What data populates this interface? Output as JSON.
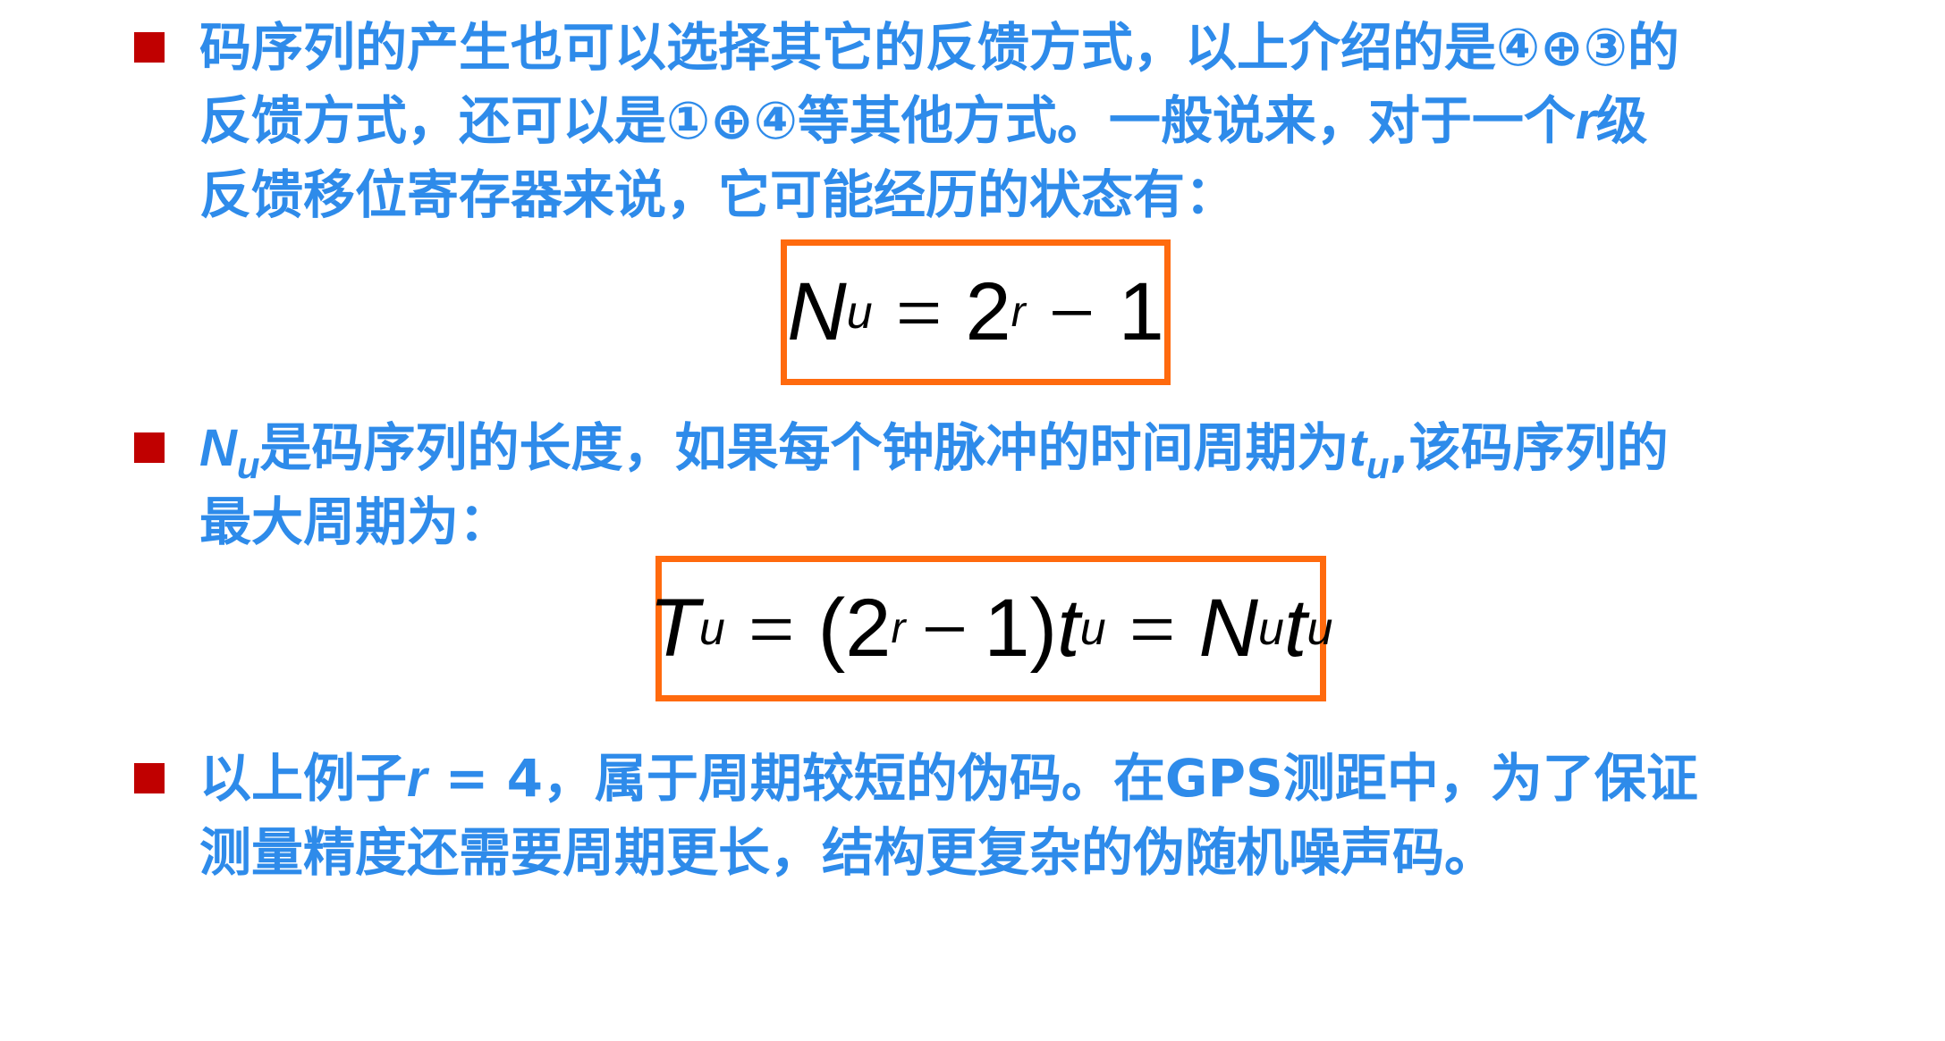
{
  "colors": {
    "text": "#2e8bea",
    "bullet": "#c00000",
    "formula_border": "#ff6a0e",
    "formula_text": "#000000"
  },
  "bullet1": {
    "line1": "码序列的产生也可以选择其它的反馈方式，以上介绍的是④⊕③的",
    "line2_a": "反馈方式，还可以是①⊕④等其他方式。一般说来，对于一个",
    "line2_var": "r",
    "line2_b": "级",
    "line3": "反馈移位寄存器来说，它可能经历的状态有："
  },
  "formula1": {
    "lhs": "N",
    "lhs_sub": "u",
    "eq": "=",
    "base": "2",
    "exp": "r",
    "minus": "−",
    "one": "1"
  },
  "bullet2": {
    "var_n": "N",
    "var_n_sub": "u",
    "line1_a": "是码序列的长度，如果每个钟脉冲的时间周期为",
    "var_t": "t",
    "var_t_sub": "u",
    "line1_b": ",该码序列的",
    "line2": "最大周期为："
  },
  "formula2": {
    "lhs": "T",
    "lhs_sub": "u",
    "eq1": "=",
    "open": "(",
    "base": "2",
    "exp": "r",
    "minus": "−",
    "one": "1",
    "close": ")",
    "t": "t",
    "t_sub": "u",
    "eq2": "=",
    "n": "N",
    "n_sub": "u",
    "t2": "t",
    "t2_sub": "u"
  },
  "bullet3": {
    "line1_a": "以上例子",
    "var_r": "r",
    "line1_b": " = 4，属于周期较短的伪码。在GPS测距中，为了保证",
    "line2": "测量精度还需要周期更长，结构更复杂的伪随机噪声码。"
  }
}
